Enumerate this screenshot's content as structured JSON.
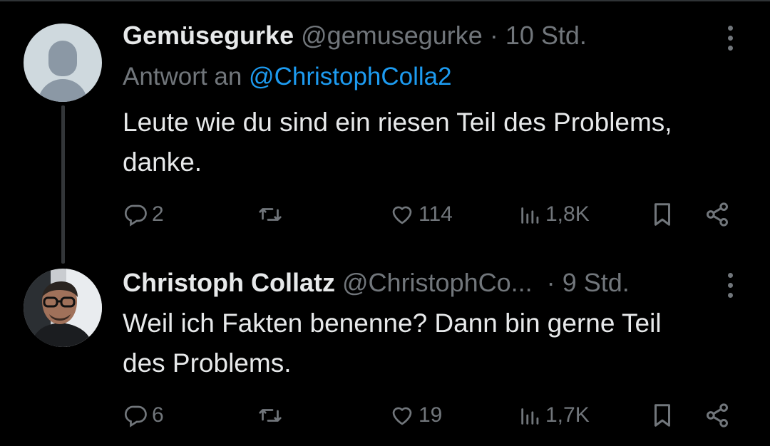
{
  "tweets": [
    {
      "name": "Gemüsegurke",
      "handle": "@gemusegurke",
      "separator": "·",
      "time": "10 Std.",
      "reply_prefix": "Antwort an",
      "reply_mention": "@ChristophColla2",
      "text_line1": "Leute wie du sind ein riesen Teil des Problems,",
      "text_line2": "danke.",
      "replies": "2",
      "likes": "114",
      "views": "1,8K"
    },
    {
      "name": "Christoph Collatz",
      "handle": "@ChristophCo...",
      "separator": "·",
      "time": "9 Std.",
      "text_line1": "Weil ich Fakten benenne? Dann bin gerne Teil",
      "text_line2": "des Problems.",
      "replies": "6",
      "likes": "19",
      "views": "1,7K"
    }
  ],
  "icons": {
    "reply": "reply-icon",
    "retweet": "retweet-icon",
    "like": "heart-icon",
    "views": "views-icon",
    "bookmark": "bookmark-icon",
    "share": "share-icon",
    "more": "more-icon"
  },
  "colors": {
    "background": "#000000",
    "text": "#e7e9ea",
    "secondary": "#71767b",
    "accent": "#1d9bf0"
  }
}
